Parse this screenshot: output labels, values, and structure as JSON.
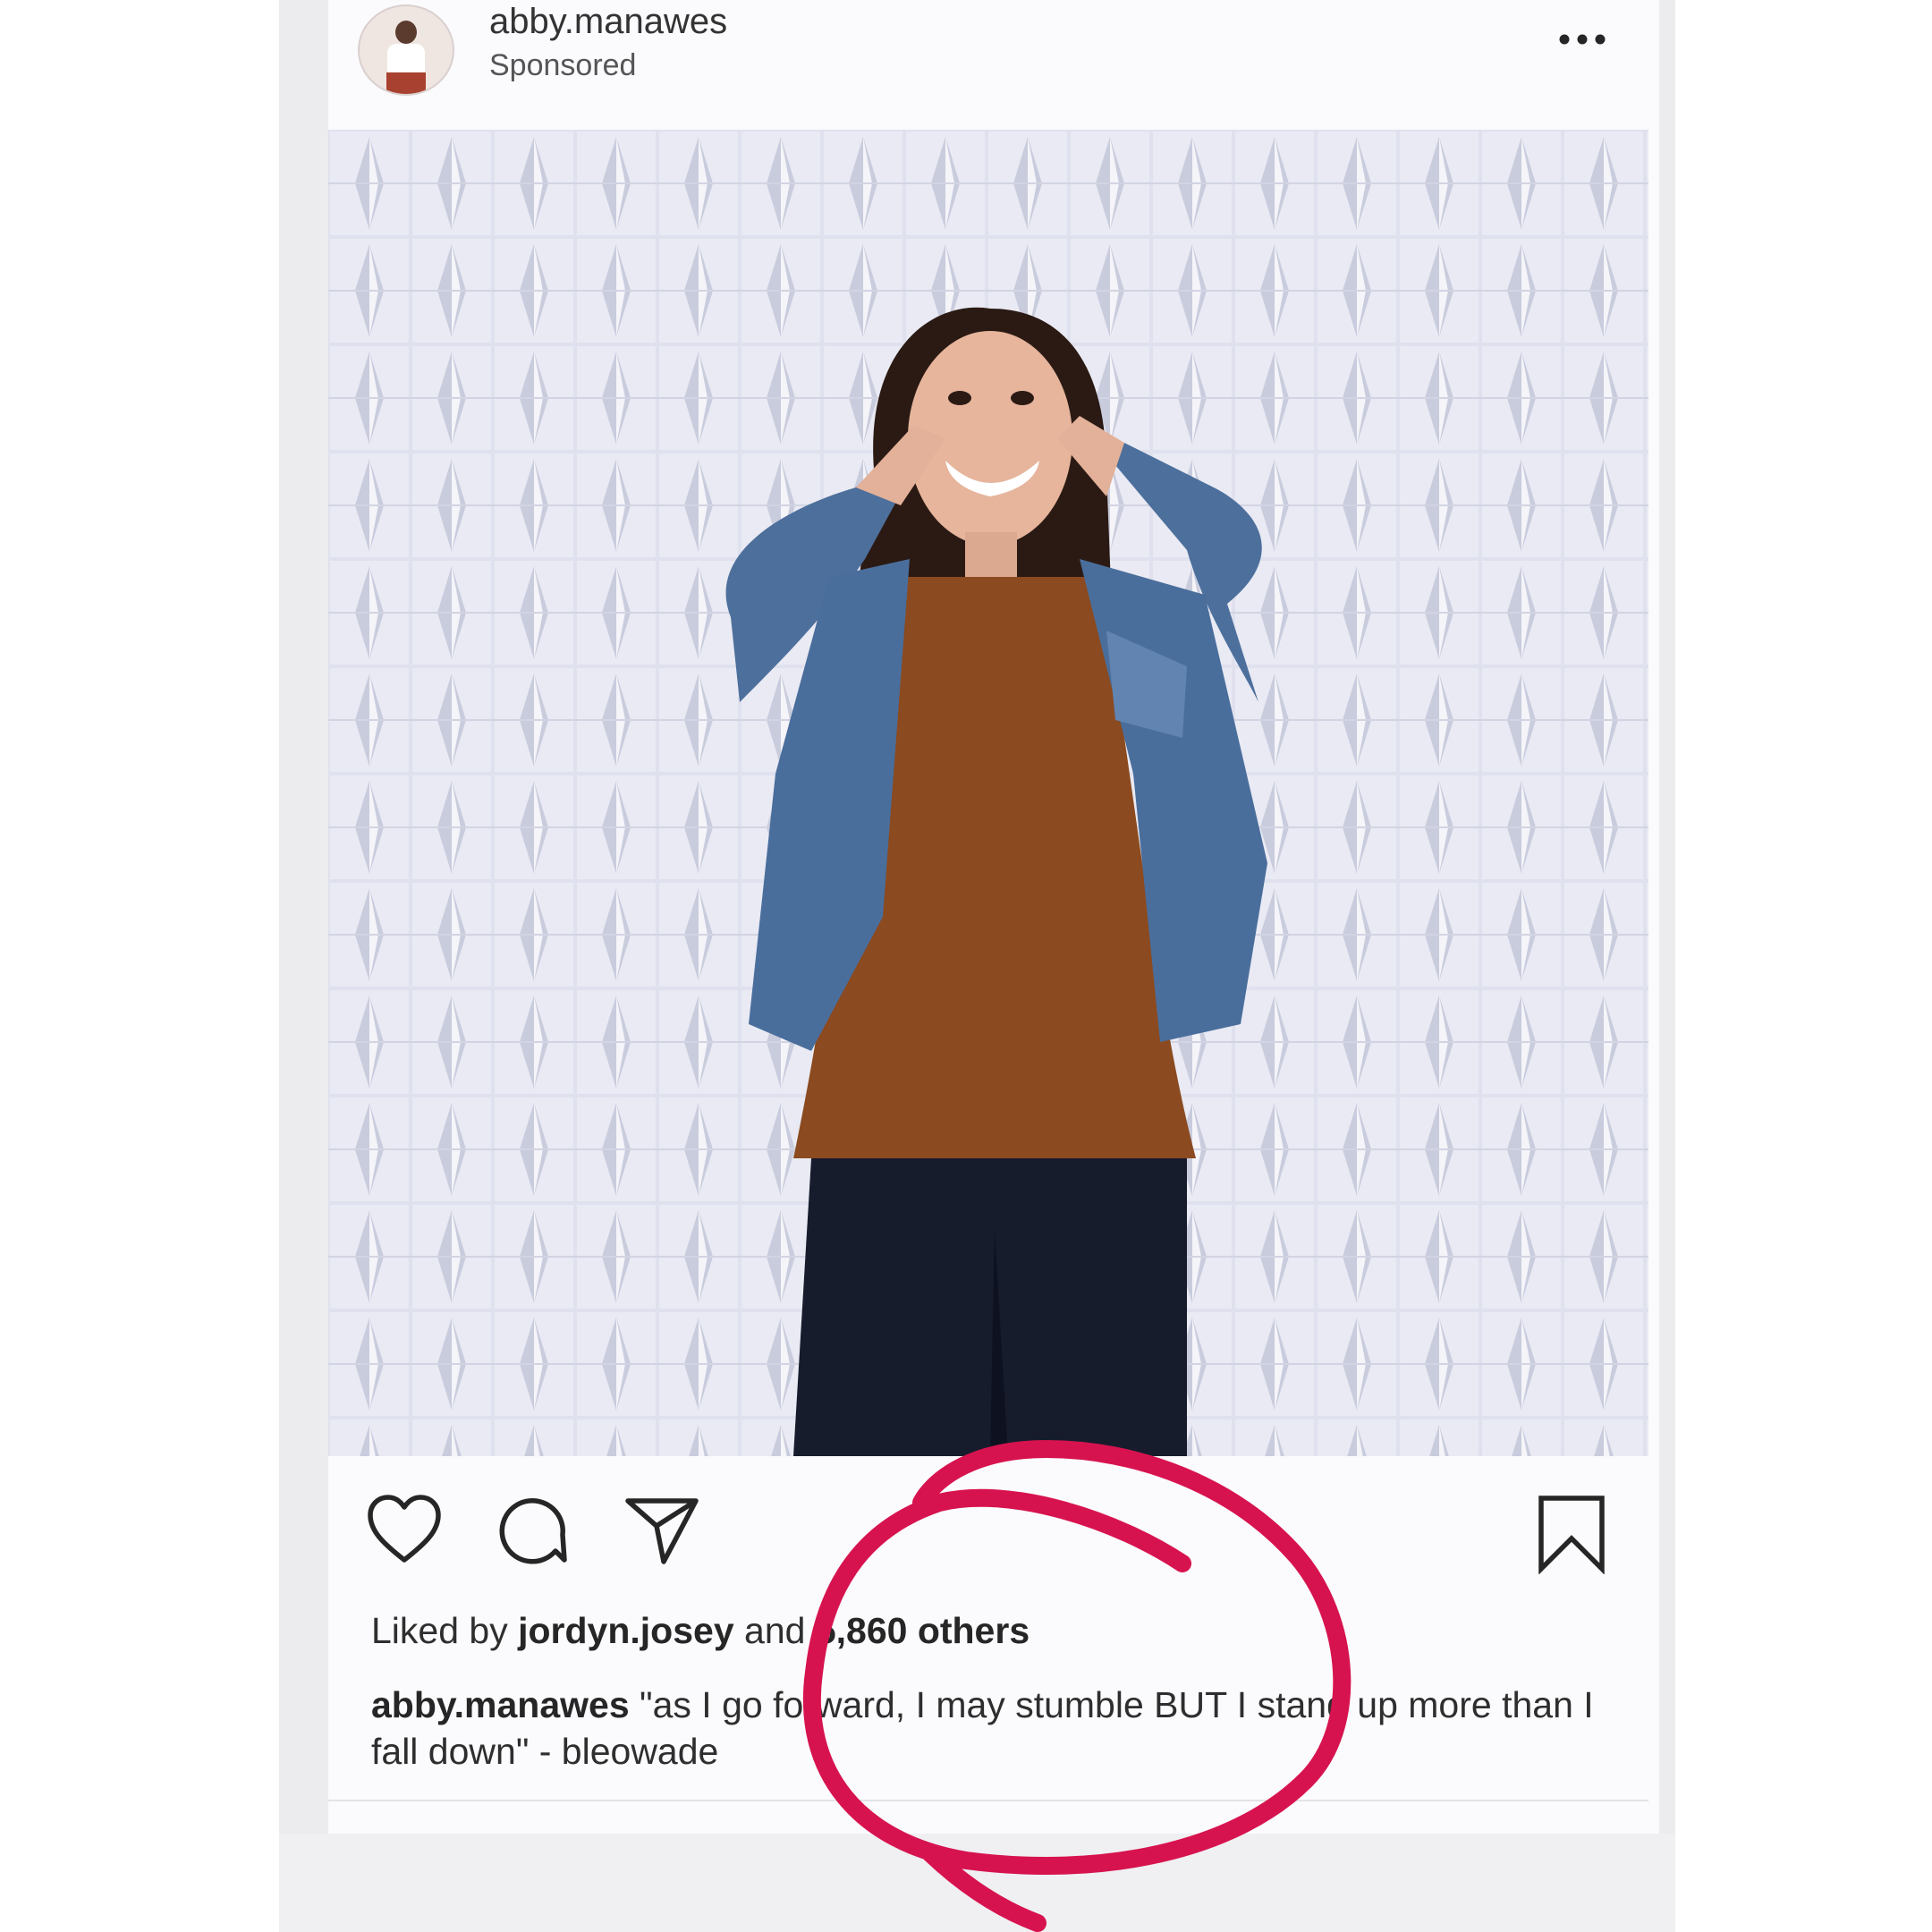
{
  "post": {
    "username": "abby.manawes",
    "sponsored_label": "Sponsored",
    "likes": {
      "prefix": "Liked by ",
      "liker": "jordyn.josey",
      "middle": " and ",
      "count_text": "5,860 others"
    },
    "caption": {
      "author": "abby.manawes",
      "text": " \"as I go forward, I may stumble BUT I stand up more than I fall down\" - bleowade"
    }
  },
  "icons": {
    "more": "more-options-icon",
    "like": "heart-icon",
    "comment": "comment-icon",
    "share": "share-icon",
    "save": "bookmark-icon"
  },
  "colors": {
    "annotation": "#d7134f",
    "text": "#262626",
    "denim": "#4a6e9c",
    "shirt": "#8b4a1f"
  }
}
